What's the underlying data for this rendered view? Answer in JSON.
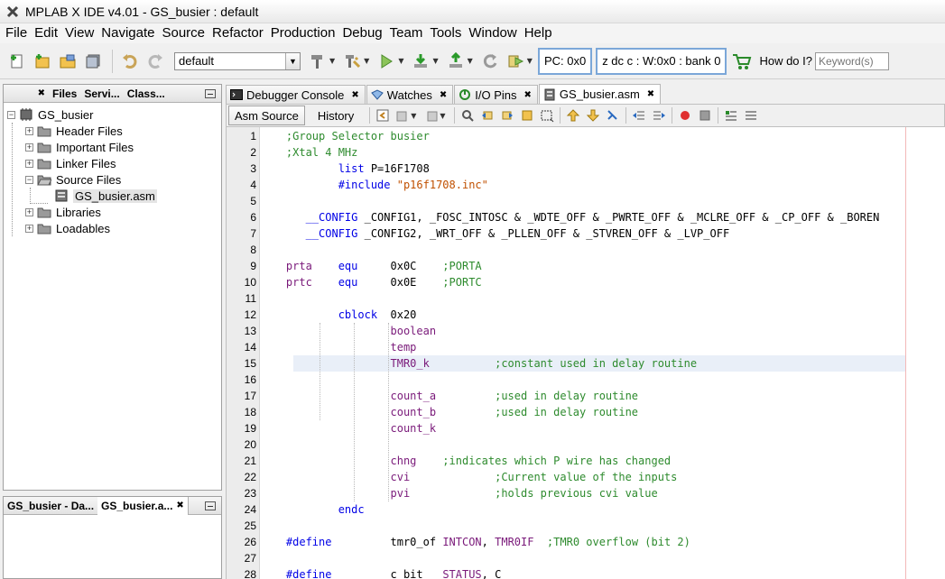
{
  "window": {
    "title": "MPLAB X IDE v4.01 - GS_busier : default"
  },
  "menu": [
    "File",
    "Edit",
    "View",
    "Navigate",
    "Source",
    "Refactor",
    "Production",
    "Debug",
    "Team",
    "Tools",
    "Window",
    "Help"
  ],
  "toolbar": {
    "config_value": "default",
    "pc_status": "PC: 0x0",
    "reg_status": "z dc c  : W:0x0 : bank 0",
    "how_do_i": "How do I?",
    "search_placeholder": "Keyword(s)"
  },
  "project_panel": {
    "tabs": [
      "Files",
      "Servi...",
      "Class..."
    ],
    "tree": {
      "root": "GS_busier",
      "items": [
        {
          "label": "Header Files",
          "level": 1,
          "expanded": false
        },
        {
          "label": "Important Files",
          "level": 1,
          "expanded": false
        },
        {
          "label": "Linker Files",
          "level": 1,
          "expanded": false
        },
        {
          "label": "Source Files",
          "level": 1,
          "expanded": true
        },
        {
          "label": "GS_busier.asm",
          "level": 2,
          "file": true
        },
        {
          "label": "Libraries",
          "level": 1,
          "expanded": false
        },
        {
          "label": "Loadables",
          "level": 1,
          "expanded": false
        }
      ]
    }
  },
  "dashboard_panel": {
    "tabs": [
      "GS_busier - Da...",
      "GS_busier.a..."
    ]
  },
  "editor_tabs": [
    {
      "label": "Debugger Console",
      "icon": "console-icon"
    },
    {
      "label": "Watches",
      "icon": "watches-icon"
    },
    {
      "label": "I/O Pins",
      "icon": "io-pins-icon"
    },
    {
      "label": "GS_busier.asm",
      "icon": "asm-file-icon",
      "active": true
    }
  ],
  "editor_modes": {
    "source": "Asm Source",
    "history": "History"
  },
  "code_lines": [
    {
      "n": "1",
      "t": [
        [
          "c",
          "    ;Group Selector busier"
        ]
      ]
    },
    {
      "n": "2",
      "t": [
        [
          "c",
          "    ;Xtal 4 MHz"
        ]
      ]
    },
    {
      "n": "3",
      "t": [
        [
          "k",
          "            list"
        ],
        [
          "o",
          " P=16F1708"
        ]
      ]
    },
    {
      "n": "4",
      "t": [
        [
          "k",
          "            #include"
        ],
        [
          "s",
          " \"p16f1708.inc\""
        ]
      ]
    },
    {
      "n": "5",
      "t": []
    },
    {
      "n": "6",
      "t": [
        [
          "k",
          "       __CONFIG"
        ],
        [
          "o",
          " _CONFIG1, _FOSC_INTOSC & _WDTE_OFF & _PWRTE_OFF & _MCLRE_OFF & _CP_OFF & _BOREN"
        ]
      ]
    },
    {
      "n": "7",
      "t": [
        [
          "k",
          "       __CONFIG"
        ],
        [
          "o",
          " _CONFIG2, _WRT_OFF & _PLLEN_OFF & _STVREN_OFF & _LVP_OFF"
        ]
      ]
    },
    {
      "n": "8",
      "t": []
    },
    {
      "n": "9",
      "t": [
        [
          "l",
          "    prta"
        ],
        [
          "k",
          "    equ"
        ],
        [
          "o",
          "     0x0C    "
        ],
        [
          "c",
          ";PORTA"
        ]
      ]
    },
    {
      "n": "10",
      "t": [
        [
          "l",
          "    prtc"
        ],
        [
          "k",
          "    equ"
        ],
        [
          "o",
          "     0x0E    "
        ],
        [
          "c",
          ";PORTC"
        ]
      ]
    },
    {
      "n": "11",
      "t": []
    },
    {
      "n": "12",
      "t": [
        [
          "k",
          "            cblock"
        ],
        [
          "o",
          "  0x20"
        ]
      ]
    },
    {
      "n": "13",
      "t": [
        [
          "l",
          "                    boolean"
        ]
      ]
    },
    {
      "n": "14",
      "t": [
        [
          "l",
          "                    temp"
        ]
      ]
    },
    {
      "n": "15",
      "t": [
        [
          "l",
          "                    TMR0_k          "
        ],
        [
          "c",
          ";constant used in delay routine"
        ]
      ]
    },
    {
      "n": "16",
      "t": []
    },
    {
      "n": "17",
      "t": [
        [
          "l",
          "                    count_a         "
        ],
        [
          "c",
          ";used in delay routine"
        ]
      ]
    },
    {
      "n": "18",
      "t": [
        [
          "l",
          "                    count_b         "
        ],
        [
          "c",
          ";used in delay routine"
        ]
      ]
    },
    {
      "n": "19",
      "t": [
        [
          "l",
          "                    count_k"
        ]
      ]
    },
    {
      "n": "20",
      "t": []
    },
    {
      "n": "21",
      "t": [
        [
          "l",
          "                    chng    "
        ],
        [
          "c",
          ";indicates which P wire has changed"
        ]
      ]
    },
    {
      "n": "22",
      "t": [
        [
          "l",
          "                    cvi             "
        ],
        [
          "c",
          ";Current value of the inputs"
        ]
      ]
    },
    {
      "n": "23",
      "t": [
        [
          "l",
          "                    pvi             "
        ],
        [
          "c",
          ";holds previous cvi value"
        ]
      ]
    },
    {
      "n": "24",
      "t": [
        [
          "k",
          "            endc"
        ]
      ]
    },
    {
      "n": "25",
      "t": []
    },
    {
      "n": "26",
      "t": [
        [
          "k",
          "    #define"
        ],
        [
          "o",
          "         tmr0_of "
        ],
        [
          "l",
          "INTCON"
        ],
        [
          "o",
          ", "
        ],
        [
          "l",
          "TMR0IF"
        ],
        [
          "c",
          "  ;TMR0 overflow (bit 2)"
        ]
      ]
    },
    {
      "n": "27",
      "t": []
    },
    {
      "n": "28",
      "t": [
        [
          "k",
          "    #define"
        ],
        [
          "o",
          "         c_bit   "
        ],
        [
          "l",
          "STATUS"
        ],
        [
          "o",
          ", C"
        ]
      ]
    }
  ],
  "current_line": 15,
  "colors": {
    "comment": "#2e8b2e",
    "keyword": "#0000e6",
    "label": "#7a1a7a",
    "string": "#c05000",
    "current_line_bg": "#e9eff8",
    "margin_line": "#f3b8b8"
  }
}
